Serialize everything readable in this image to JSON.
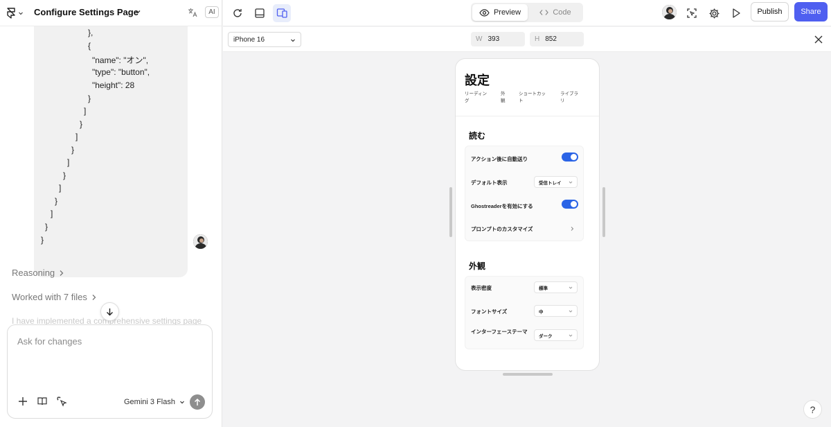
{
  "project": {
    "title": "Configure Settings Page",
    "ai_badge": "AI"
  },
  "chat": {
    "code_lines": [
      "},",
      "{",
      "\"name\": \"オン\",",
      "\"type\": \"button\",",
      "\"height\": 28",
      "}",
      "]",
      "}",
      "]",
      "}",
      "]",
      "}",
      "]",
      "}",
      "]",
      "}",
      "}"
    ],
    "reasoning_label": "Reasoning",
    "files_label": "Worked with 7 files",
    "faded_text": "I have implemented a comprehensive settings page"
  },
  "composer": {
    "placeholder": "Ask for changes",
    "model": "Gemini 3 Flash"
  },
  "toolbar": {
    "preview_label": "Preview",
    "code_label": "Code",
    "publish_label": "Publish",
    "share_label": "Share",
    "accent": "#4f5ff0"
  },
  "device": {
    "name": "iPhone 16",
    "w_label": "W",
    "w_value": "393",
    "h_label": "H",
    "h_value": "852"
  },
  "settings": {
    "title": "設定",
    "tabs": [
      "リーディング",
      "外観",
      "ショートカット",
      "ライブラリ"
    ],
    "reading": {
      "heading": "読む",
      "auto_advance": "アクション後に自動送り",
      "default_view": "デフォルト表示",
      "default_view_value": "受信トレイ",
      "ghostreader": "Ghostreaderを有効にする",
      "prompt_custom": "プロンプトのカスタマイズ"
    },
    "appearance": {
      "heading": "外観",
      "density": "表示密度",
      "density_value": "標準",
      "font_size": "フォントサイズ",
      "font_size_value": "中",
      "theme": "インターフェーステーマ",
      "theme_value": "ダーク"
    },
    "toggle_color": "#2b64e6"
  },
  "help_label": "?"
}
